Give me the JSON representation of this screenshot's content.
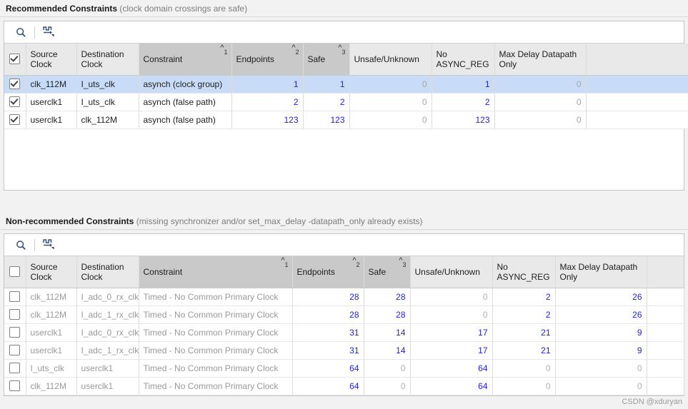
{
  "sections": [
    {
      "title_strong": "Recommended Constraints",
      "title_muted": "(clock domain crossings are safe)",
      "toolbar": {
        "search_icon": "search-icon",
        "clock_icon": "clock-waveform-icon"
      },
      "columns": [
        {
          "label": "Source\nClock",
          "sorted": false,
          "sort_index": ""
        },
        {
          "label": "Destination\nClock",
          "sorted": false,
          "sort_index": ""
        },
        {
          "label": "Constraint",
          "sorted": true,
          "sort_index": "1"
        },
        {
          "label": "Endpoints",
          "sorted": true,
          "sort_index": "2"
        },
        {
          "label": "Safe",
          "sorted": true,
          "sort_index": "3"
        },
        {
          "label": "Unsafe/Unknown",
          "sorted": false,
          "sort_index": ""
        },
        {
          "label": "No\nASYNC_REG",
          "sorted": false,
          "sort_index": ""
        },
        {
          "label": "Max Delay Datapath\nOnly",
          "sorted": false,
          "sort_index": ""
        }
      ],
      "header_checkbox_checked": true,
      "rows": [
        {
          "checked": true,
          "selected": true,
          "dim": false,
          "source": "clk_112M",
          "destination": "I_uts_clk",
          "constraint": "asynch (clock group)",
          "endpoints": "1",
          "safe": "1",
          "unsafe": "0",
          "no_async_reg": "1",
          "max_delay": "0"
        },
        {
          "checked": true,
          "selected": false,
          "dim": false,
          "source": "userclk1",
          "destination": "I_uts_clk",
          "constraint": "asynch (false path)",
          "endpoints": "2",
          "safe": "2",
          "unsafe": "0",
          "no_async_reg": "2",
          "max_delay": "0"
        },
        {
          "checked": true,
          "selected": false,
          "dim": false,
          "source": "userclk1",
          "destination": "clk_112M",
          "constraint": "asynch (false path)",
          "endpoints": "123",
          "safe": "123",
          "unsafe": "0",
          "no_async_reg": "123",
          "max_delay": "0"
        }
      ]
    },
    {
      "title_strong": "Non-recommended Constraints",
      "title_muted": "(missing synchronizer and/or set_max_delay -datapath_only already exists)",
      "toolbar": {
        "search_icon": "search-icon",
        "clock_icon": "clock-waveform-icon"
      },
      "columns": [
        {
          "label": "Source\nClock",
          "sorted": false,
          "sort_index": ""
        },
        {
          "label": "Destination\nClock",
          "sorted": false,
          "sort_index": ""
        },
        {
          "label": "Constraint",
          "sorted": true,
          "sort_index": "1"
        },
        {
          "label": "Endpoints",
          "sorted": true,
          "sort_index": "2"
        },
        {
          "label": "Safe",
          "sorted": true,
          "sort_index": "3"
        },
        {
          "label": "Unsafe/Unknown",
          "sorted": false,
          "sort_index": ""
        },
        {
          "label": "No\nASYNC_REG",
          "sorted": false,
          "sort_index": ""
        },
        {
          "label": "Max Delay Datapath\nOnly",
          "sorted": false,
          "sort_index": ""
        }
      ],
      "header_checkbox_checked": false,
      "rows": [
        {
          "checked": false,
          "selected": false,
          "dim": true,
          "source": "clk_112M",
          "destination": "I_adc_0_rx_clk",
          "constraint": "Timed - No Common Primary Clock",
          "endpoints": "28",
          "safe": "28",
          "unsafe": "0",
          "no_async_reg": "2",
          "max_delay": "26"
        },
        {
          "checked": false,
          "selected": false,
          "dim": true,
          "source": "clk_112M",
          "destination": "I_adc_1_rx_clk",
          "constraint": "Timed - No Common Primary Clock",
          "endpoints": "28",
          "safe": "28",
          "unsafe": "0",
          "no_async_reg": "2",
          "max_delay": "26"
        },
        {
          "checked": false,
          "selected": false,
          "dim": true,
          "source": "userclk1",
          "destination": "I_adc_0_rx_clk",
          "constraint": "Timed - No Common Primary Clock",
          "endpoints": "31",
          "safe": "14",
          "unsafe": "17",
          "no_async_reg": "21",
          "max_delay": "9"
        },
        {
          "checked": false,
          "selected": false,
          "dim": true,
          "source": "userclk1",
          "destination": "I_adc_1_rx_clk",
          "constraint": "Timed - No Common Primary Clock",
          "endpoints": "31",
          "safe": "14",
          "unsafe": "17",
          "no_async_reg": "21",
          "max_delay": "9"
        },
        {
          "checked": false,
          "selected": false,
          "dim": true,
          "source": "I_uts_clk",
          "destination": "userclk1",
          "constraint": "Timed - No Common Primary Clock",
          "endpoints": "64",
          "safe": "0",
          "unsafe": "64",
          "no_async_reg": "0",
          "max_delay": "0"
        },
        {
          "checked": false,
          "selected": false,
          "dim": true,
          "source": "clk_112M",
          "destination": "userclk1",
          "constraint": "Timed - No Common Primary Clock",
          "endpoints": "64",
          "safe": "0",
          "unsafe": "64",
          "no_async_reg": "0",
          "max_delay": "0"
        }
      ]
    }
  ],
  "watermark": "CSDN @xduryan",
  "colors": {
    "selected_row": "#c9dcf7",
    "sorted_header": "#c9c9c9",
    "header": "#e9e9e9",
    "value_blue": "#2222dd",
    "zero_gray": "#a6a6a6",
    "dim_text": "#9a9a9a"
  }
}
